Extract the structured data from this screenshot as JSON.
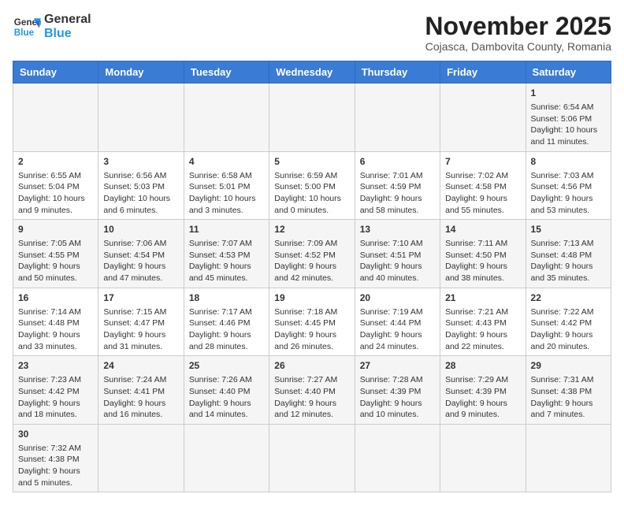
{
  "header": {
    "logo_general": "General",
    "logo_blue": "Blue",
    "month_title": "November 2025",
    "subtitle": "Cojasca, Dambovita County, Romania"
  },
  "days_of_week": [
    "Sunday",
    "Monday",
    "Tuesday",
    "Wednesday",
    "Thursday",
    "Friday",
    "Saturday"
  ],
  "weeks": [
    [
      {
        "day": "",
        "info": ""
      },
      {
        "day": "",
        "info": ""
      },
      {
        "day": "",
        "info": ""
      },
      {
        "day": "",
        "info": ""
      },
      {
        "day": "",
        "info": ""
      },
      {
        "day": "",
        "info": ""
      },
      {
        "day": "1",
        "info": "Sunrise: 6:54 AM\nSunset: 5:06 PM\nDaylight: 10 hours and 11 minutes."
      }
    ],
    [
      {
        "day": "2",
        "info": "Sunrise: 6:55 AM\nSunset: 5:04 PM\nDaylight: 10 hours and 9 minutes."
      },
      {
        "day": "3",
        "info": "Sunrise: 6:56 AM\nSunset: 5:03 PM\nDaylight: 10 hours and 6 minutes."
      },
      {
        "day": "4",
        "info": "Sunrise: 6:58 AM\nSunset: 5:01 PM\nDaylight: 10 hours and 3 minutes."
      },
      {
        "day": "5",
        "info": "Sunrise: 6:59 AM\nSunset: 5:00 PM\nDaylight: 10 hours and 0 minutes."
      },
      {
        "day": "6",
        "info": "Sunrise: 7:01 AM\nSunset: 4:59 PM\nDaylight: 9 hours and 58 minutes."
      },
      {
        "day": "7",
        "info": "Sunrise: 7:02 AM\nSunset: 4:58 PM\nDaylight: 9 hours and 55 minutes."
      },
      {
        "day": "8",
        "info": "Sunrise: 7:03 AM\nSunset: 4:56 PM\nDaylight: 9 hours and 53 minutes."
      }
    ],
    [
      {
        "day": "9",
        "info": "Sunrise: 7:05 AM\nSunset: 4:55 PM\nDaylight: 9 hours and 50 minutes."
      },
      {
        "day": "10",
        "info": "Sunrise: 7:06 AM\nSunset: 4:54 PM\nDaylight: 9 hours and 47 minutes."
      },
      {
        "day": "11",
        "info": "Sunrise: 7:07 AM\nSunset: 4:53 PM\nDaylight: 9 hours and 45 minutes."
      },
      {
        "day": "12",
        "info": "Sunrise: 7:09 AM\nSunset: 4:52 PM\nDaylight: 9 hours and 42 minutes."
      },
      {
        "day": "13",
        "info": "Sunrise: 7:10 AM\nSunset: 4:51 PM\nDaylight: 9 hours and 40 minutes."
      },
      {
        "day": "14",
        "info": "Sunrise: 7:11 AM\nSunset: 4:50 PM\nDaylight: 9 hours and 38 minutes."
      },
      {
        "day": "15",
        "info": "Sunrise: 7:13 AM\nSunset: 4:48 PM\nDaylight: 9 hours and 35 minutes."
      }
    ],
    [
      {
        "day": "16",
        "info": "Sunrise: 7:14 AM\nSunset: 4:48 PM\nDaylight: 9 hours and 33 minutes."
      },
      {
        "day": "17",
        "info": "Sunrise: 7:15 AM\nSunset: 4:47 PM\nDaylight: 9 hours and 31 minutes."
      },
      {
        "day": "18",
        "info": "Sunrise: 7:17 AM\nSunset: 4:46 PM\nDaylight: 9 hours and 28 minutes."
      },
      {
        "day": "19",
        "info": "Sunrise: 7:18 AM\nSunset: 4:45 PM\nDaylight: 9 hours and 26 minutes."
      },
      {
        "day": "20",
        "info": "Sunrise: 7:19 AM\nSunset: 4:44 PM\nDaylight: 9 hours and 24 minutes."
      },
      {
        "day": "21",
        "info": "Sunrise: 7:21 AM\nSunset: 4:43 PM\nDaylight: 9 hours and 22 minutes."
      },
      {
        "day": "22",
        "info": "Sunrise: 7:22 AM\nSunset: 4:42 PM\nDaylight: 9 hours and 20 minutes."
      }
    ],
    [
      {
        "day": "23",
        "info": "Sunrise: 7:23 AM\nSunset: 4:42 PM\nDaylight: 9 hours and 18 minutes."
      },
      {
        "day": "24",
        "info": "Sunrise: 7:24 AM\nSunset: 4:41 PM\nDaylight: 9 hours and 16 minutes."
      },
      {
        "day": "25",
        "info": "Sunrise: 7:26 AM\nSunset: 4:40 PM\nDaylight: 9 hours and 14 minutes."
      },
      {
        "day": "26",
        "info": "Sunrise: 7:27 AM\nSunset: 4:40 PM\nDaylight: 9 hours and 12 minutes."
      },
      {
        "day": "27",
        "info": "Sunrise: 7:28 AM\nSunset: 4:39 PM\nDaylight: 9 hours and 10 minutes."
      },
      {
        "day": "28",
        "info": "Sunrise: 7:29 AM\nSunset: 4:39 PM\nDaylight: 9 hours and 9 minutes."
      },
      {
        "day": "29",
        "info": "Sunrise: 7:31 AM\nSunset: 4:38 PM\nDaylight: 9 hours and 7 minutes."
      }
    ],
    [
      {
        "day": "30",
        "info": "Sunrise: 7:32 AM\nSunset: 4:38 PM\nDaylight: 9 hours and 5 minutes."
      },
      {
        "day": "",
        "info": ""
      },
      {
        "day": "",
        "info": ""
      },
      {
        "day": "",
        "info": ""
      },
      {
        "day": "",
        "info": ""
      },
      {
        "day": "",
        "info": ""
      },
      {
        "day": "",
        "info": ""
      }
    ]
  ]
}
